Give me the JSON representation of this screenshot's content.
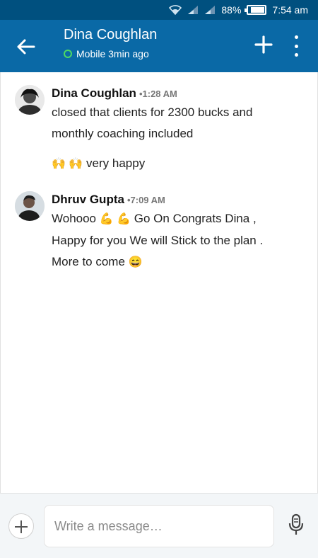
{
  "status_bar": {
    "battery_percent": "88%",
    "time": "7:54 am",
    "battery_level": 0.88
  },
  "header": {
    "title": "Dina Coughlan",
    "presence": "Mobile 3min ago",
    "presence_color": "#4cd964",
    "bar_color": "#0a69a6",
    "status_color": "#00507f"
  },
  "messages": [
    {
      "sender": "Dina Coughlan",
      "time": "•1:28 AM",
      "lines": [
        "closed that clients for 2300 bucks and",
        "monthly coaching included"
      ],
      "extra": {
        "emoji": "🙌 🙌",
        "text": "very happy"
      }
    },
    {
      "sender": "Dhruv Gupta",
      "time": "•7:09 AM",
      "line1_pre": "Wohooo",
      "line1_emoji": "💪 💪",
      "line1_post": "Go On Congrats Dina ,",
      "line2": "Happy for you We will Stick to the plan .",
      "line3_pre": "More to come",
      "line3_emoji": "😄"
    }
  ],
  "composer": {
    "placeholder": "Write a message…"
  }
}
